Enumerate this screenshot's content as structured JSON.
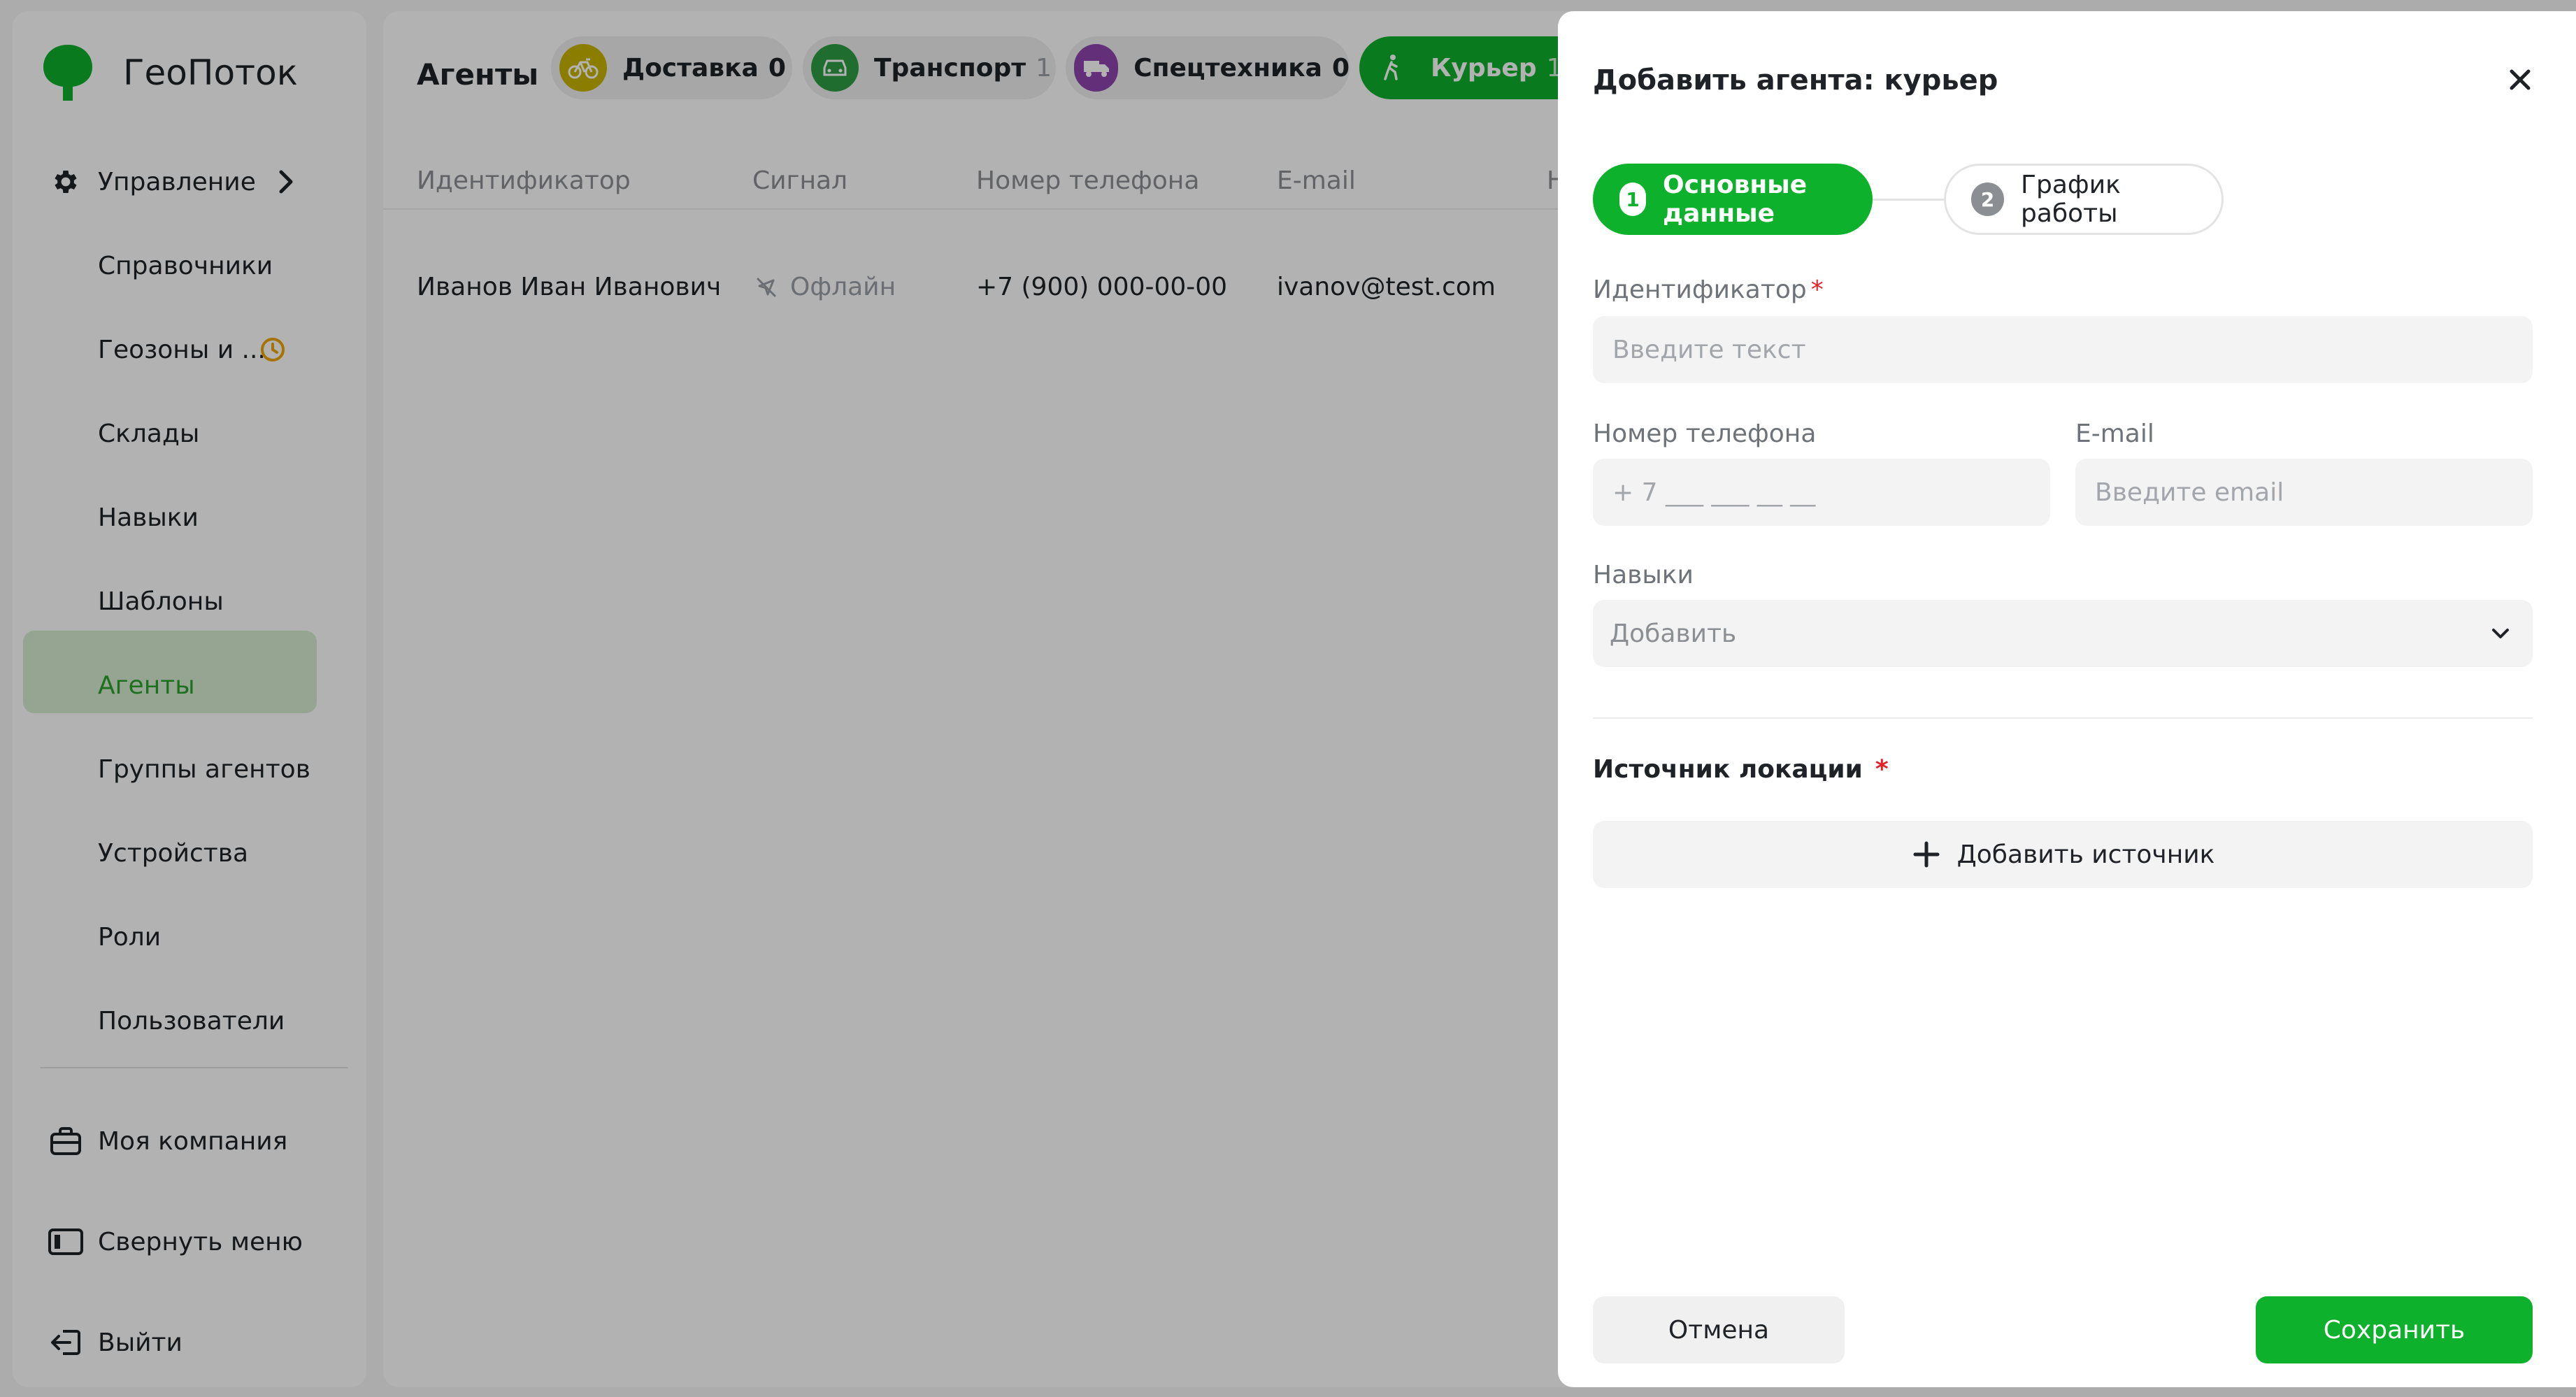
{
  "brand": {
    "name": "ГеоПоток",
    "accent": "#0db12b"
  },
  "sidebar": {
    "management": "Управление",
    "items": [
      {
        "label": "Справочники"
      },
      {
        "label": "Геозоны и ..."
      },
      {
        "label": "Склады"
      },
      {
        "label": "Навыки"
      },
      {
        "label": "Шаблоны"
      },
      {
        "label": "Агенты"
      },
      {
        "label": "Группы агентов"
      },
      {
        "label": "Устройства"
      },
      {
        "label": "Роли"
      },
      {
        "label": "Пользователи"
      }
    ],
    "company": "Моя компания",
    "collapse": "Свернуть меню",
    "logout": "Выйти"
  },
  "main": {
    "title": "Агенты",
    "chips": [
      {
        "label": "Доставка",
        "count": "0",
        "color": "#c7b300"
      },
      {
        "label": "Транспорт",
        "count": "1",
        "color": "#2f9e44"
      },
      {
        "label": "Спецтехника",
        "count": "0",
        "color": "#8e44ad"
      },
      {
        "label": "Курьер",
        "count": "1",
        "color": "#0db12b"
      }
    ],
    "columns": [
      "Идентификатор",
      "Сигнал",
      "Номер телефона",
      "E-mail",
      "Н"
    ],
    "rows": [
      {
        "id": "Иванов Иван Иванович",
        "signal": "Офлайн",
        "phone": "+7 (900) 000-00-00",
        "email": "ivanov@test.com"
      }
    ]
  },
  "drawer": {
    "title": "Добавить агента: курьер",
    "steps": [
      {
        "num": "1",
        "label": "Основные данные"
      },
      {
        "num": "2",
        "label": "График работы"
      }
    ],
    "id_label": "Идентификатор",
    "id_placeholder": "Введите текст",
    "phone_label": "Номер телефона",
    "phone_placeholder": "+ 7 ___ ___ __ __",
    "email_label": "E-mail",
    "email_placeholder": "Введите email",
    "skills_label": "Навыки",
    "skills_value": "Добавить",
    "location_title": "Источник локации",
    "add_source": "Добавить источник",
    "cancel": "Отмена",
    "save": "Сохранить",
    "required_mark": "*"
  }
}
